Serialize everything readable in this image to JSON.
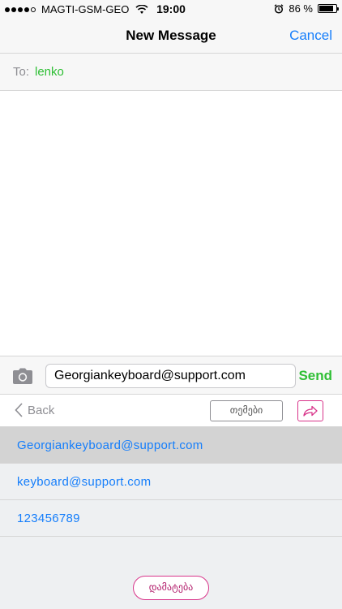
{
  "status_bar": {
    "carrier": "MAGTI-GSM-GEO",
    "time": "19:00",
    "battery_text": "86 %",
    "battery_level": 0.86,
    "signal_bars_filled": 4,
    "signal_bars_total": 5
  },
  "nav": {
    "title": "New Message",
    "cancel_label": "Cancel"
  },
  "recipient": {
    "label": "To:",
    "value": "lenko"
  },
  "compose": {
    "input_value": "Georgiankeyboard@support.com",
    "send_label": "Send"
  },
  "keyboard_toolbar": {
    "back_label": "Back",
    "themes_label": "თემები"
  },
  "suggestions": [
    {
      "text": "Georgiankeyboard@support.com",
      "selected": true
    },
    {
      "text": "keyboard@support.com",
      "selected": false
    },
    {
      "text": "123456789",
      "selected": false
    }
  ],
  "add_button_label": "დამატება",
  "colors": {
    "ios_blue": "#157efb",
    "send_green": "#2fbf35",
    "accent_pink": "#d8348a"
  },
  "icons": [
    "signal-dots-icon",
    "wifi-icon",
    "alarm-icon",
    "battery-icon",
    "camera-icon",
    "chevron-left-icon",
    "share-arrow-icon"
  ]
}
